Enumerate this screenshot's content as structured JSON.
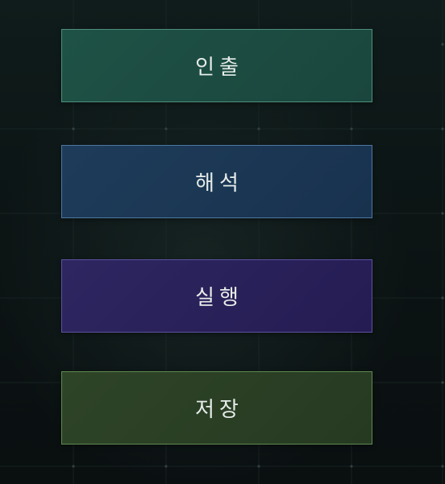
{
  "stages": [
    {
      "label": "인출",
      "color": "#1f5246"
    },
    {
      "label": "해석",
      "color": "#1e3c5a"
    },
    {
      "label": "실행",
      "color": "#2e2660"
    },
    {
      "label": "저장",
      "color": "#2e4427"
    }
  ],
  "background": "#0c1414"
}
